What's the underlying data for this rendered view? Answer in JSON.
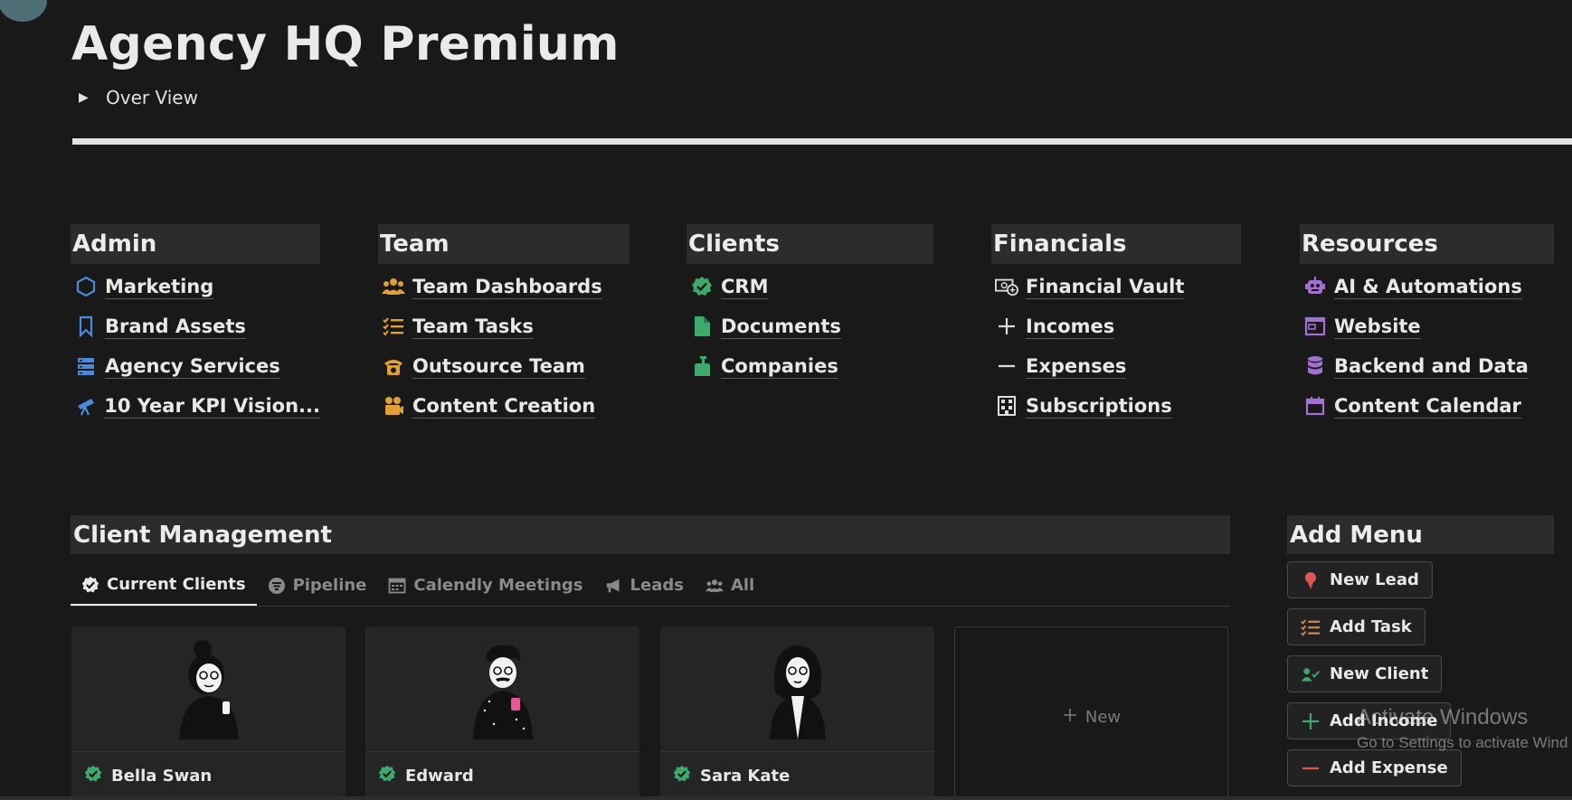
{
  "page": {
    "title": "Agency HQ Premium",
    "toggle_label": "Over View"
  },
  "colors": {
    "background": "#191919",
    "admin_icon": "#4a8ad8",
    "team_icon": "#e0a035",
    "clients_icon": "#3fa96c",
    "financial_icon": "#dcdcdc",
    "resources_icon": "#a26fd3",
    "red_icon": "#e05555"
  },
  "categories": [
    {
      "title": "Admin",
      "items": [
        {
          "label": "Marketing",
          "icon": "hexagon-icon"
        },
        {
          "label": "Brand Assets",
          "icon": "bookmark-icon"
        },
        {
          "label": "Agency Services",
          "icon": "server-stack-icon"
        },
        {
          "label": "10 Year KPI Vision...",
          "icon": "telescope-icon"
        }
      ]
    },
    {
      "title": "Team",
      "items": [
        {
          "label": "Team Dashboards",
          "icon": "people-group-icon"
        },
        {
          "label": "Team Tasks",
          "icon": "checklist-icon"
        },
        {
          "label": "Outsource Team",
          "icon": "telephone-icon"
        },
        {
          "label": "Content Creation",
          "icon": "movie-camera-icon"
        }
      ]
    },
    {
      "title": "Clients",
      "items": [
        {
          "label": "CRM",
          "icon": "verified-badge-icon"
        },
        {
          "label": "Documents",
          "icon": "document-icon"
        },
        {
          "label": "Companies",
          "icon": "soap-bottle-icon"
        }
      ]
    },
    {
      "title": "Financials",
      "items": [
        {
          "label": "Financial Vault",
          "icon": "money-vault-icon"
        },
        {
          "label": "Incomes",
          "icon": "plus-icon"
        },
        {
          "label": "Expenses",
          "icon": "minus-icon"
        },
        {
          "label": "Subscriptions",
          "icon": "building-icon"
        }
      ]
    },
    {
      "title": "Resources",
      "items": [
        {
          "label": "AI & Automations",
          "icon": "robot-icon"
        },
        {
          "label": "Website",
          "icon": "browser-window-icon"
        },
        {
          "label": "Backend and Data",
          "icon": "database-icon"
        },
        {
          "label": "Content Calendar",
          "icon": "calendar-icon"
        }
      ]
    }
  ],
  "client_management": {
    "title": "Client Management",
    "tabs": [
      {
        "label": "Current Clients",
        "icon": "verified-badge-icon",
        "active": true
      },
      {
        "label": "Pipeline",
        "icon": "filter-icon",
        "active": false
      },
      {
        "label": "Calendly Meetings",
        "icon": "calendar-grid-icon",
        "active": false
      },
      {
        "label": "Leads",
        "icon": "megaphone-icon",
        "active": false
      },
      {
        "label": "All",
        "icon": "people-group-icon",
        "active": false
      }
    ],
    "cards": [
      {
        "name": "Bella Swan"
      },
      {
        "name": "Edward"
      },
      {
        "name": "Sara Kate"
      }
    ],
    "new_label": "New"
  },
  "add_menu": {
    "title": "Add Menu",
    "buttons": [
      {
        "label": "New Lead",
        "icon": "user-pin-icon"
      },
      {
        "label": "Add Task",
        "icon": "checklist-icon"
      },
      {
        "label": "New Client",
        "icon": "user-check-icon"
      },
      {
        "label": "Add Income",
        "icon": "plus-icon"
      },
      {
        "label": "Add Expense",
        "icon": "minus-icon"
      }
    ]
  },
  "watermark": {
    "line1": "Activate Windows",
    "line2": "Go to Settings to activate Wind"
  }
}
